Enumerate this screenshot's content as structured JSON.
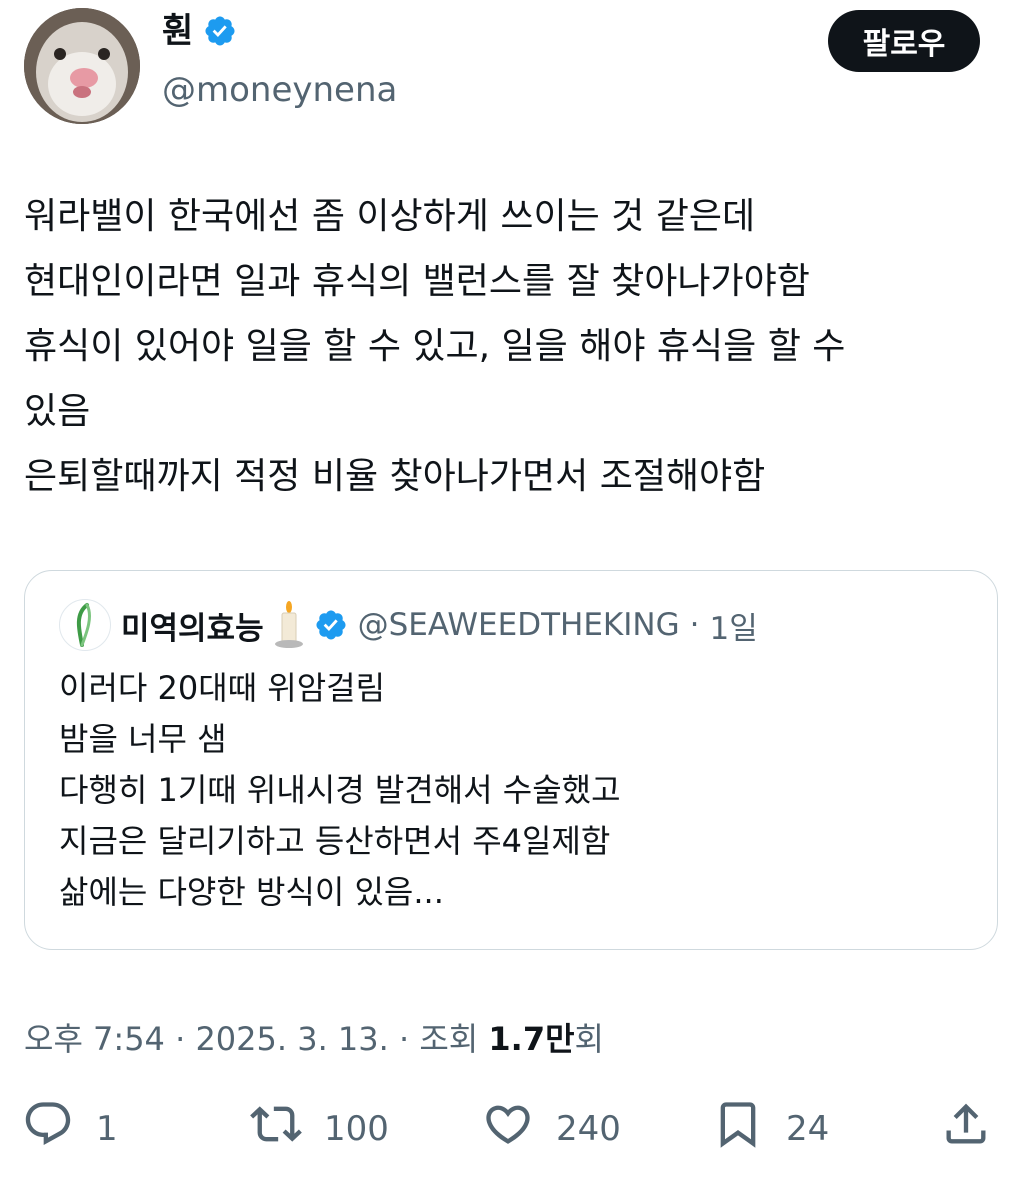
{
  "author": {
    "display_name": "훤",
    "handle": "@moneynena",
    "verified_icon": "verified-badge-icon",
    "accent": "#1d9bf0"
  },
  "follow_button": {
    "label": "팔로우"
  },
  "tweet": {
    "lines": [
      "워라밸이 한국에선 좀 이상하게 쓰이는 것 같은데",
      "현대인이라면 일과 휴식의 밸런스를 잘 찾아나가야함",
      "휴식이 있어야 일을 할 수 있고, 일을 해야 휴식을 할 수",
      "있음",
      "은퇴할때까지 적정 비율 찾아나가면서 조절해야함"
    ]
  },
  "quote": {
    "name": "미역의효능",
    "handle": "@SEAWEEDTHEKING",
    "separator": "·",
    "time": "1일",
    "lines": [
      "이러다 20대때 위암걸림",
      "밤을 너무 샘",
      "다행히 1기때 위내시경 발견해서 수술했고",
      "지금은 달리기하고 등산하면서 주4일제함",
      "삶에는 다양한 방식이 있음..."
    ]
  },
  "meta": {
    "time": "오후 7:54",
    "sep1": "·",
    "date": "2025. 3. 13.",
    "sep2": "·",
    "views_label": "조회",
    "views_num": "1.7만",
    "views_suffix": "회"
  },
  "actions": {
    "reply_count": "1",
    "retweet_count": "100",
    "like_count": "240",
    "bookmark_count": "24"
  }
}
